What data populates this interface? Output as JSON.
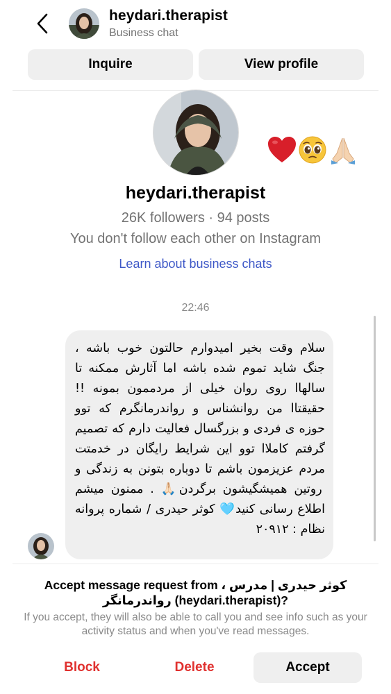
{
  "header": {
    "username": "heydari.therapist",
    "subtitle": "Business chat"
  },
  "actions_top": {
    "inquire_label": "Inquire",
    "view_profile_label": "View profile"
  },
  "profile": {
    "name": "heydari.therapist",
    "stats": "26K followers · 94 posts",
    "follow_status": "You don't follow each other on Instagram",
    "learn_link": "Learn about business chats",
    "reaction_emojis": [
      "red-heart",
      "pleading-face",
      "folded-hands"
    ]
  },
  "chat": {
    "timestamp": "22:46",
    "message": "سلام وقت بخیر امیدوارم حالتون خوب باشه ، جنگ شاید تموم شده باشه اما آثارش ممکنه تا سالهاا روی روان خیلی از مردممون بمونه !! حقیقتاا من روانشناس و رواندرمانگرم که توو حوزه ی فردی و بزرگسال فعالیت دارم که تصمیم گرفتم کاملاا توو این شرایط رایگان در خدمتت مردم عزیزمون باشم تا دوباره بتونن به زندگی و روتین همیشگیشون برگردن🙏🏻 . ممنون میشم اطلاع رسانی کنید🩵 کوثر حیدری / شماره پروانه نظام : ۲۰۹۱۲"
  },
  "request": {
    "title": "Accept message request from کوثر حیدری | مدرس ، رواندرمانگر (heydari.therapist)?",
    "description": "If you accept, they will also be able to call you and see info such as your activity status and when you've read messages.",
    "block_label": "Block",
    "delete_label": "Delete",
    "accept_label": "Accept"
  },
  "colors": {
    "link_blue": "#3d57c7",
    "danger_red": "#e0312f",
    "bubble_gray": "#efefef",
    "muted_text": "#737373"
  }
}
